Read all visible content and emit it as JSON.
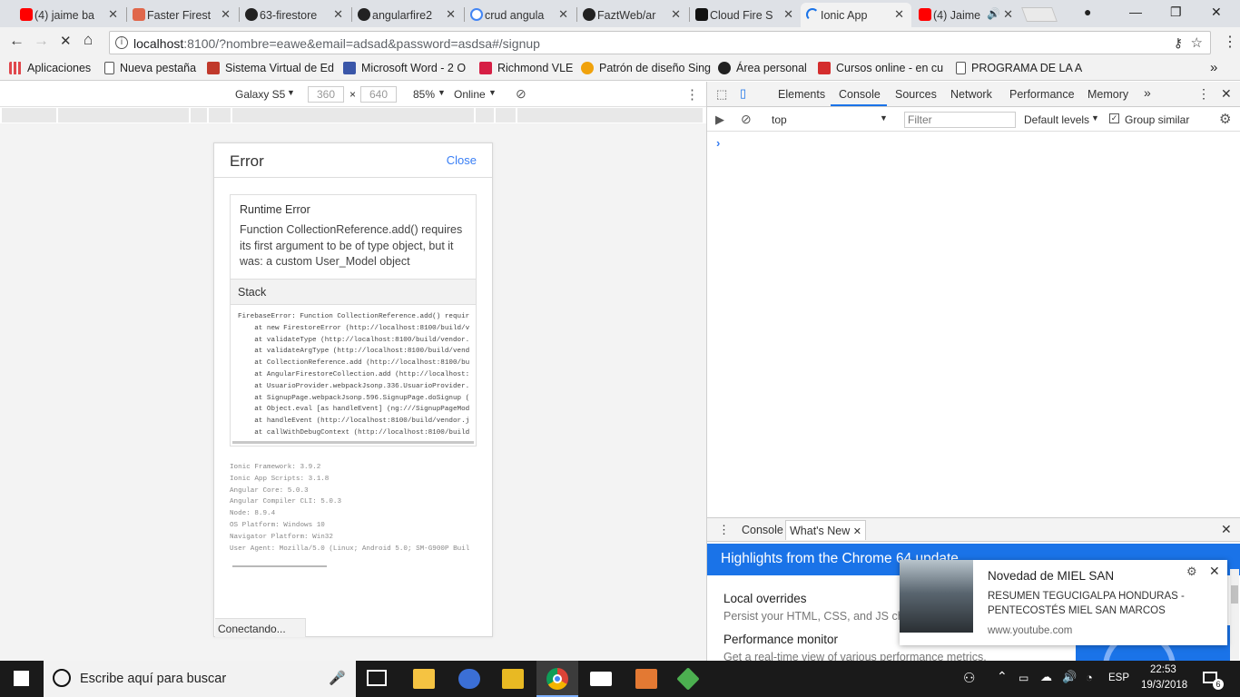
{
  "browser": {
    "tabs": [
      {
        "label": "(4) jaime ba",
        "icon": "youtube-icon",
        "color": "#ff0000"
      },
      {
        "label": "Faster Firest",
        "icon": "angular-icon",
        "color": "#e0674b"
      },
      {
        "label": "63-firestore",
        "icon": "github-icon",
        "color": "#222222"
      },
      {
        "label": "angularfire2",
        "icon": "github-icon",
        "color": "#222222"
      },
      {
        "label": "crud angula",
        "icon": "google-icon",
        "color": "#4285f4"
      },
      {
        "label": "FaztWeb/ar",
        "icon": "github-icon",
        "color": "#222222"
      },
      {
        "label": "Cloud Fire S",
        "icon": "medium-icon",
        "color": "#111111"
      },
      {
        "label": "Ionic App",
        "icon": "loading-icon",
        "color": "#1a73e8"
      },
      {
        "label": "(4) Jaime",
        "icon": "youtube-icon",
        "color": "#ff0000"
      }
    ],
    "active_tab_index": 7,
    "url_host": "localhost",
    "url_rest": ":8100/?nombre=eawe&email=adsad&password=asdsa#/signup"
  },
  "bookmarks": [
    {
      "label": "Aplicaciones",
      "icon": "apps-grid-icon",
      "color": "#e0474c"
    },
    {
      "label": "Nueva pestaña",
      "icon": "page-icon",
      "color": "#ffffff"
    },
    {
      "label": "Sistema Virtual de Ed",
      "icon": "bookmark-red-icon",
      "color": "#c0392b"
    },
    {
      "label": "Microsoft Word - 2 O",
      "icon": "bookmark-doc-icon",
      "color": "#3a56a8"
    },
    {
      "label": "Richmond VLE",
      "icon": "bookmark-r-icon",
      "color": "#d61f45"
    },
    {
      "label": "Patrón de diseño Sing",
      "icon": "bookmark-orange-icon",
      "color": "#f0a20c"
    },
    {
      "label": "Área personal",
      "icon": "bookmark-user-icon",
      "color": "#222222"
    },
    {
      "label": "Cursos online - en cu",
      "icon": "bookmark-u-icon",
      "color": "#d42d2d"
    },
    {
      "label": "PROGRAMA DE LA A",
      "icon": "page-icon",
      "color": "#ffffff"
    }
  ],
  "device_toolbar": {
    "device": "Galaxy S5",
    "width": "360",
    "height": "640",
    "zoom": "85%",
    "network": "Online"
  },
  "error_page": {
    "title": "Error",
    "close_label": "Close",
    "runtime_title": "Runtime Error",
    "runtime_message": "Function CollectionReference.add() requires its first argument to be of type object, but it was: a custom User_Model object",
    "stack_title": "Stack",
    "stack_lines": [
      "FirebaseError: Function CollectionReference.add() requir",
      "    at new FirestoreError (http://localhost:8100/build/v",
      "    at validateType (http://localhost:8100/build/vendor.",
      "    at validateArgType (http://localhost:8100/build/vend",
      "    at CollectionReference.add (http://localhost:8100/bu",
      "    at AngularFirestoreCollection.add (http://localhost:",
      "    at UsuarioProvider.webpackJsonp.336.UsuarioProvider.",
      "    at SignupPage.webpackJsonp.596.SignupPage.doSignup (",
      "    at Object.eval [as handleEvent] (ng:///SignupPageMod",
      "    at handleEvent (http://localhost:8100/build/vendor.j",
      "    at callWithDebugContext (http://localhost:8100/build"
    ],
    "info_lines": [
      "Ionic Framework: 3.9.2",
      "Ionic App Scripts: 3.1.8",
      "Angular Core: 5.0.3",
      "Angular Compiler CLI: 5.0.3",
      "Node: 8.9.4",
      "OS Platform: Windows 10",
      "Navigator Platform: Win32",
      "User Agent: Mozilla/5.0 (Linux; Android 5.0; SM-G900P Buil"
    ],
    "status": "Conectando..."
  },
  "devtools": {
    "tabs": [
      "Elements",
      "Console",
      "Sources",
      "Network",
      "Performance",
      "Memory"
    ],
    "active_tab": "Console",
    "context": "top",
    "filter_placeholder": "Filter",
    "levels": "Default levels",
    "group_similar": "Group similar",
    "prompt": "›",
    "drawer_tabs": [
      "Console",
      "What's New"
    ],
    "drawer_active": "What's New",
    "banner": "Highlights from the Chrome 64 update",
    "features": [
      {
        "title": "Local overrides",
        "desc": "Persist your HTML, CSS, and JS cha"
      },
      {
        "title": "Performance monitor",
        "desc": "Get a real-time view of various performance metrics."
      }
    ]
  },
  "notification": {
    "title": "Novedad de MIEL SAN",
    "body": "RESUMEN TEGUCIGALPA HONDURAS - PENTECOSTÉS MIEL SAN MARCOS",
    "source": "www.youtube.com"
  },
  "taskbar": {
    "search_placeholder": "Escribe aquí para buscar",
    "language": "ESP",
    "time": "22:53",
    "date": "19/3/2018",
    "notification_count": "6"
  }
}
